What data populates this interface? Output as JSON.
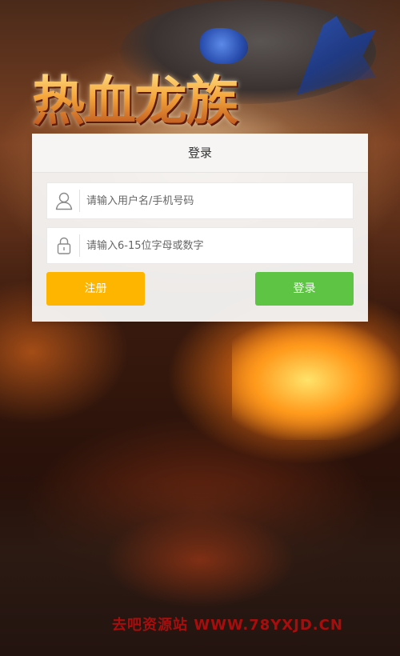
{
  "game": {
    "title": "热血龙族"
  },
  "login_panel": {
    "header": "登录",
    "username_field": {
      "placeholder": "请输入用户名/手机号码",
      "value": "",
      "icon": "user-icon"
    },
    "password_field": {
      "placeholder": "请输入6-15位字母或数字",
      "value": "",
      "icon": "lock-icon"
    },
    "register_button": {
      "label": "注册",
      "color": "#fdb500"
    },
    "login_button": {
      "label": "登录",
      "color": "#5dc543"
    }
  },
  "watermark": {
    "text": "去吧资源站  WWW.78YXJD.CN"
  }
}
